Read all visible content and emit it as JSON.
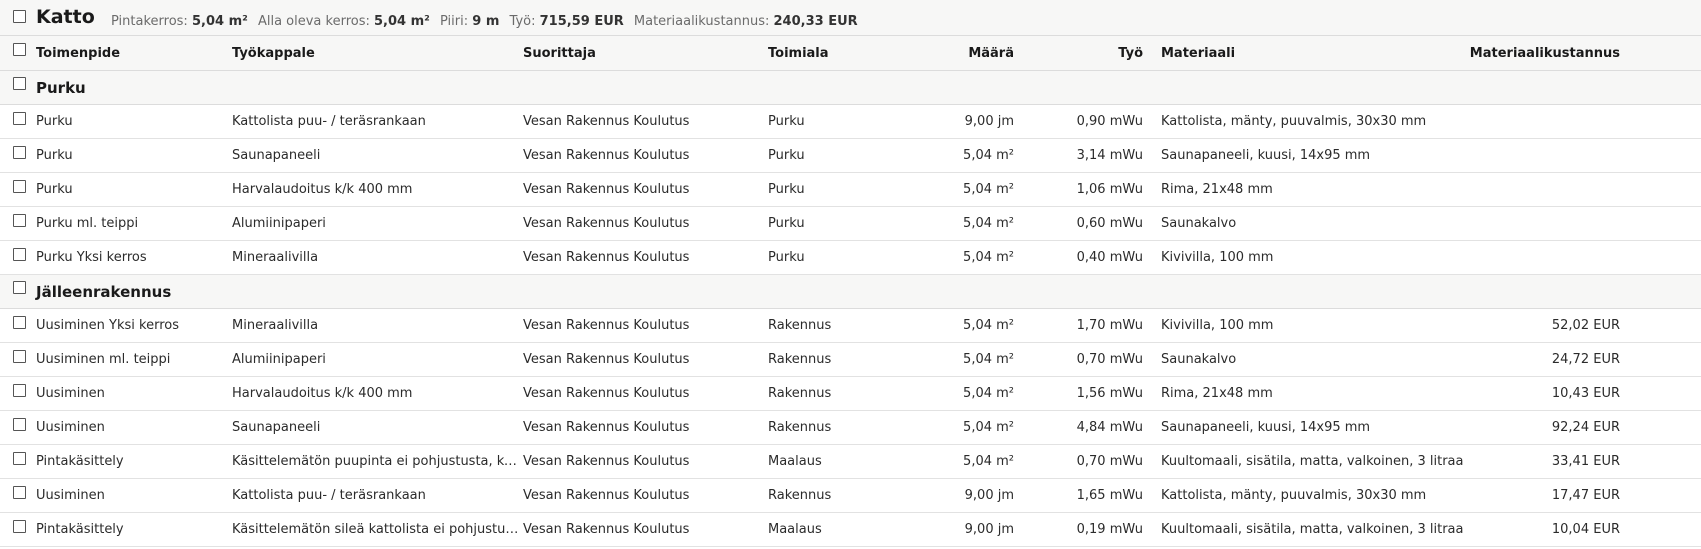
{
  "section": {
    "title": "Katto",
    "summary": [
      {
        "label": "Pintakerros:",
        "value": "5,04 m²"
      },
      {
        "label": "Alla oleva kerros:",
        "value": "5,04 m²"
      },
      {
        "label": "Piiri:",
        "value": "9 m"
      },
      {
        "label": "Työ:",
        "value": "715,59 EUR"
      },
      {
        "label": "Materiaalikustannus:",
        "value": "240,33 EUR"
      }
    ]
  },
  "columns": {
    "operation": "Toimenpide",
    "workpiece": "Työkappale",
    "executor": "Suorittaja",
    "trade": "Toimiala",
    "quantity": "Määrä",
    "work": "Työ",
    "material": "Materiaali",
    "material_cost": "Materiaalikustannus"
  },
  "groups": [
    {
      "title": "Purku",
      "rows": [
        {
          "operation": "Purku",
          "workpiece": "Kattolista puu- / teräsrankaan",
          "executor": "Vesan Rakennus Koulutus",
          "trade": "Purku",
          "quantity": "9,00 jm",
          "work": "0,90 mWu",
          "material": "Kattolista, mänty, puuvalmis, 30x30 mm",
          "material_cost": ""
        },
        {
          "operation": "Purku",
          "workpiece": "Saunapaneeli",
          "executor": "Vesan Rakennus Koulutus",
          "trade": "Purku",
          "quantity": "5,04 m²",
          "work": "3,14 mWu",
          "material": "Saunapaneeli, kuusi, 14x95 mm",
          "material_cost": ""
        },
        {
          "operation": "Purku",
          "workpiece": "Harvalaudoitus k/k 400 mm",
          "executor": "Vesan Rakennus Koulutus",
          "trade": "Purku",
          "quantity": "5,04 m²",
          "work": "1,06 mWu",
          "material": "Rima, 21x48 mm",
          "material_cost": ""
        },
        {
          "operation": "Purku ml. teippi",
          "workpiece": "Alumiinipaperi",
          "executor": "Vesan Rakennus Koulutus",
          "trade": "Purku",
          "quantity": "5,04 m²",
          "work": "0,60 mWu",
          "material": "Saunakalvo",
          "material_cost": ""
        },
        {
          "operation": "Purku Yksi kerros",
          "workpiece": "Mineraalivilla",
          "executor": "Vesan Rakennus Koulutus",
          "trade": "Purku",
          "quantity": "5,04 m²",
          "work": "0,40 mWu",
          "material": "Kivivilla, 100 mm",
          "material_cost": ""
        }
      ]
    },
    {
      "title": "Jälleenrakennus",
      "rows": [
        {
          "operation": "Uusiminen Yksi kerros",
          "workpiece": "Mineraalivilla",
          "executor": "Vesan Rakennus Koulutus",
          "trade": "Rakennus",
          "quantity": "5,04 m²",
          "work": "1,70 mWu",
          "material": "Kivivilla, 100 mm",
          "material_cost": "52,02 EUR"
        },
        {
          "operation": "Uusiminen ml. teippi",
          "workpiece": "Alumiinipaperi",
          "executor": "Vesan Rakennus Koulutus",
          "trade": "Rakennus",
          "quantity": "5,04 m²",
          "work": "0,70 mWu",
          "material": "Saunakalvo",
          "material_cost": "24,72 EUR"
        },
        {
          "operation": "Uusiminen",
          "workpiece": "Harvalaudoitus k/k 400 mm",
          "executor": "Vesan Rakennus Koulutus",
          "trade": "Rakennus",
          "quantity": "5,04 m²",
          "work": "1,56 mWu",
          "material": "Rima, 21x48 mm",
          "material_cost": "10,43 EUR"
        },
        {
          "operation": "Uusiminen",
          "workpiece": "Saunapaneeli",
          "executor": "Vesan Rakennus Koulutus",
          "trade": "Rakennus",
          "quantity": "5,04 m²",
          "work": "4,84 mWu",
          "material": "Saunapaneeli, kuusi, 14x95 mm",
          "material_cost": "92,24 EUR"
        },
        {
          "operation": "Pintakäsittely",
          "workpiece": "Käsittelemätön puupinta ei pohjustusta, kuu...",
          "executor": "Vesan Rakennus Koulutus",
          "trade": "Maalaus",
          "quantity": "5,04 m²",
          "work": "0,70 mWu",
          "material": "Kuultomaali, sisätila, matta, valkoinen, 3 litraa",
          "material_cost": "33,41 EUR"
        },
        {
          "operation": "Uusiminen",
          "workpiece": "Kattolista puu- / teräsrankaan",
          "executor": "Vesan Rakennus Koulutus",
          "trade": "Rakennus",
          "quantity": "9,00 jm",
          "work": "1,65 mWu",
          "material": "Kattolista, mänty, puuvalmis, 30x30 mm",
          "material_cost": "17,47 EUR"
        },
        {
          "operation": "Pintakäsittely",
          "workpiece": "Käsittelemätön sileä kattolista ei pohjustusta...",
          "executor": "Vesan Rakennus Koulutus",
          "trade": "Maalaus",
          "quantity": "9,00 jm",
          "work": "0,19 mWu",
          "material": "Kuultomaali, sisätila, matta, valkoinen, 3 litraa",
          "material_cost": "10,04 EUR"
        }
      ]
    }
  ]
}
